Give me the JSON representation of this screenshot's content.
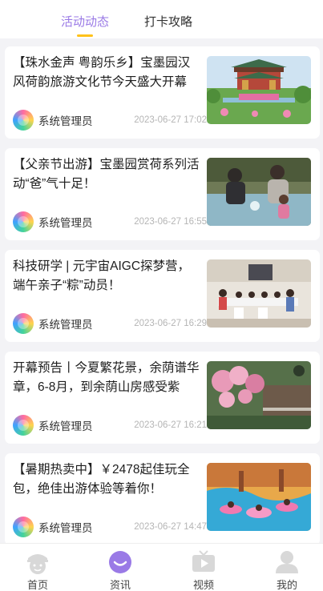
{
  "tabs": [
    {
      "label": "活动动态",
      "active": true
    },
    {
      "label": "打卡攻略",
      "active": false
    }
  ],
  "articles": [
    {
      "title": "【珠水金声 粤韵乐乡】宝墨园汉风荷韵旅游文化节今天盛大开幕",
      "author": "系统管理员",
      "time": "2023-06-27 17:02",
      "image": "pavilion-lotus-stage"
    },
    {
      "title": "【父亲节出游】宝墨园赏荷系列活动“爸”气十足！",
      "author": "系统管理员",
      "time": "2023-06-27 16:55",
      "image": "father-child-water-play"
    },
    {
      "title": "科技研学 | 元宇宙AIGC探梦营，端午亲子“粽”动员！",
      "author": "系统管理员",
      "time": "2023-06-27 16:29",
      "image": "children-classroom"
    },
    {
      "title": "开幕预告丨今夏繁花景，余荫谱华章，6-8月，到余荫山房感受紫",
      "author": "系统管理员",
      "time": "2023-06-27 16:21",
      "image": "crape-myrtle-garden"
    },
    {
      "title": "【暑期热卖中】￥2478起佳玩全包，绝佳出游体验等着你！",
      "author": "系统管理员",
      "time": "2023-06-27 14:47",
      "image": "water-park"
    }
  ],
  "nav": [
    {
      "label": "首页",
      "icon": "home-face-icon",
      "active": false
    },
    {
      "label": "资讯",
      "icon": "news-smile-icon",
      "active": true
    },
    {
      "label": "视频",
      "icon": "video-tv-icon",
      "active": false
    },
    {
      "label": "我的",
      "icon": "profile-person-icon",
      "active": false
    }
  ],
  "colors": {
    "accent": "#9a7ae6",
    "underline": "#ffc21a",
    "nav_inactive": "#d8d8d8"
  }
}
